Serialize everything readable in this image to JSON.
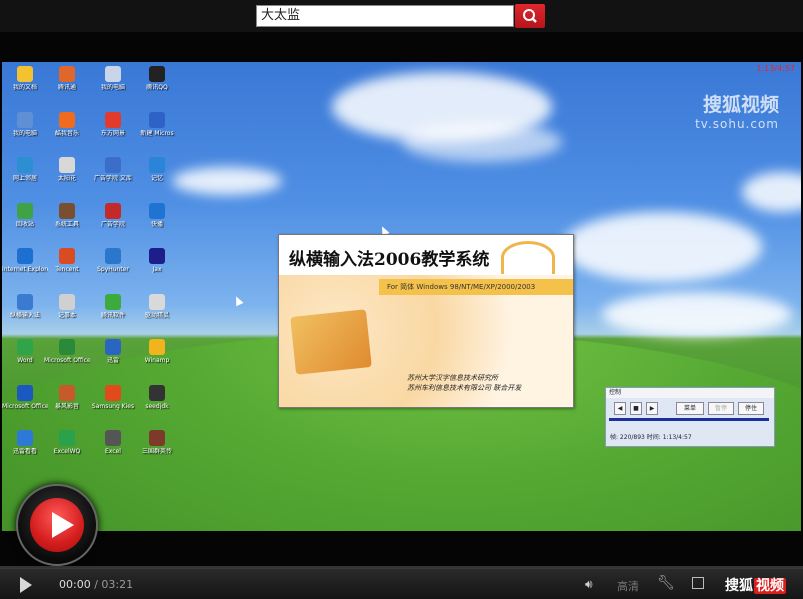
{
  "search": {
    "value": "大太监"
  },
  "video": {
    "clock": "1:13/4:57",
    "watermark": {
      "brand": "搜狐视频",
      "url": "tv.sohu.com"
    },
    "desktop_icons": [
      {
        "label": "我的文档",
        "color": "#f2c230"
      },
      {
        "label": "腾讯通",
        "color": "#e0672c"
      },
      {
        "label": "我的电脑",
        "color": "#c9d6e9"
      },
      {
        "label": "腾讯QQ",
        "color": "#222222"
      },
      {
        "label": "我的电脑",
        "color": "#5f8fd4"
      },
      {
        "label": "酷我音乐",
        "color": "#ef6b1f"
      },
      {
        "label": "东方网景",
        "color": "#e23b2c"
      },
      {
        "label": "新建 Micros",
        "color": "#2f62c6"
      },
      {
        "label": "网上邻居",
        "color": "#2b8fd2"
      },
      {
        "label": "太阳花",
        "color": "#d8d8d8"
      },
      {
        "label": "广告学院 文库",
        "color": "#3b6ec8"
      },
      {
        "label": "记忆",
        "color": "#2a84d8"
      },
      {
        "label": "回收站",
        "color": "#3fa345"
      },
      {
        "label": "系统工具",
        "color": "#7a4f2f"
      },
      {
        "label": "广告学院",
        "color": "#c42a2a"
      },
      {
        "label": "快播",
        "color": "#1f74d1"
      },
      {
        "label": "Internet Explorer",
        "color": "#1d6fd0"
      },
      {
        "label": "Tencent",
        "color": "#d94b23"
      },
      {
        "label": "SpyHunter",
        "color": "#2a77cc"
      },
      {
        "label": "Jax",
        "color": "#1e1e8a"
      },
      {
        "label": "纵横输入法",
        "color": "#3a7ad0"
      },
      {
        "label": "记事本",
        "color": "#d0d0d0"
      },
      {
        "label": "腾讯软件",
        "color": "#3daa3d"
      },
      {
        "label": "驱动精灵",
        "color": "#d9d9d9"
      },
      {
        "label": "Word",
        "color": "#2fa448"
      },
      {
        "label": "Microsoft Office",
        "color": "#2b8a3a"
      },
      {
        "label": "迅雷",
        "color": "#2a65c2"
      },
      {
        "label": "Winamp",
        "color": "#f2b41e"
      },
      {
        "label": "Microsoft Office 2",
        "color": "#1b58c0"
      },
      {
        "label": "暴风影音",
        "color": "#c65a2a"
      },
      {
        "label": "Samsung Kies",
        "color": "#e14a1d"
      },
      {
        "label": "seedjdk",
        "color": "#333333"
      },
      {
        "label": "迅雷看看",
        "color": "#2d7ad6"
      },
      {
        "label": "ExcelWQ",
        "color": "#2aa14a"
      },
      {
        "label": "Excel",
        "color": "#555555"
      },
      {
        "label": "三国群英传",
        "color": "#7d3a2a"
      }
    ],
    "splash": {
      "title": "纵横输入法2006教学系统",
      "for_line": "For 简体 Windows 98/NT/ME/XP/2000/2003",
      "credit_1": "苏州大学汉字信息技术研究所",
      "credit_2": "苏州车利信息技术有限公司  联合开发"
    },
    "control_panel": {
      "title": "控制",
      "btn_menu": "菜单",
      "btn_disabled": "暂停",
      "btn_stop": "停住",
      "info": "帧: 220/893  时间: 1:13/4:57"
    }
  },
  "player": {
    "time_current": "00:00",
    "time_separator": "/",
    "time_total": "03:21",
    "progress": 0.0,
    "volume_icon": "speaker-icon",
    "quality_label": "高清",
    "brand_left": "搜狐",
    "brand_right": "视频"
  }
}
